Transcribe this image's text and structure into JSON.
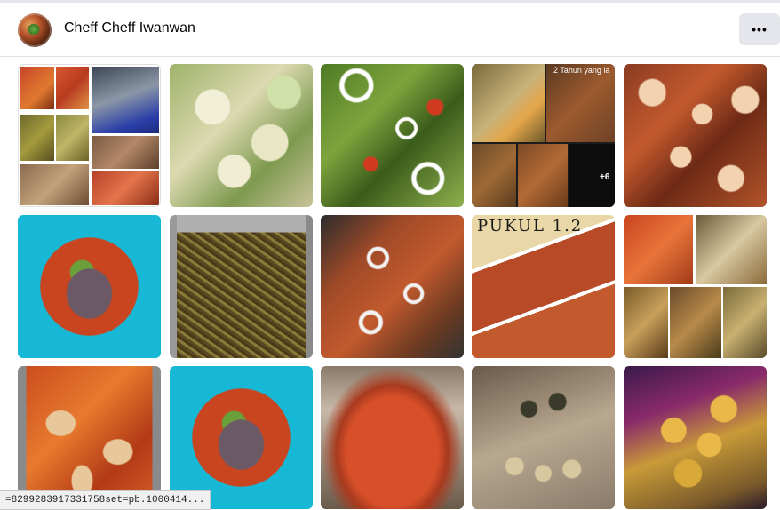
{
  "header": {
    "page_name": "Cheff Cheff Iwanwan",
    "more_label": "•••"
  },
  "photos": [
    {
      "name": "photo-collage-trays",
      "desc": "food trays collage",
      "extra_label": ""
    },
    {
      "name": "photo-vegetable-salad",
      "desc": "",
      "extra_label": ""
    },
    {
      "name": "photo-green-bean-stirfry",
      "desc": "",
      "extra_label": ""
    },
    {
      "name": "photo-collage-containers",
      "desc": "",
      "extra_label": "+6",
      "timestamp": "2 Tahun yang la"
    },
    {
      "name": "photo-noodle-boxes",
      "desc": "",
      "extra_label": ""
    },
    {
      "name": "photo-beef-soup-blue",
      "desc": "",
      "extra_label": ""
    },
    {
      "name": "photo-fried-noodles-tray",
      "desc": "",
      "extra_label": ""
    },
    {
      "name": "photo-fish-onion-tray",
      "desc": "",
      "extra_label": ""
    },
    {
      "name": "photo-fish-collage",
      "desc": "",
      "extra_label": "",
      "overlay": "PUKUL 1.2"
    },
    {
      "name": "photo-noodle-collage",
      "desc": "",
      "extra_label": ""
    },
    {
      "name": "photo-chicken-curry-tray",
      "desc": "",
      "extra_label": ""
    },
    {
      "name": "photo-beef-soup-blue-2",
      "desc": "",
      "extra_label": ""
    },
    {
      "name": "photo-red-sauce-pot",
      "desc": "",
      "extra_label": ""
    },
    {
      "name": "photo-jars-table",
      "desc": "",
      "extra_label": ""
    },
    {
      "name": "photo-crackers-jar",
      "desc": "",
      "extra_label": ""
    }
  ],
  "status_bar": {
    "url": "=8299283917331758set=pb.1000414..."
  }
}
